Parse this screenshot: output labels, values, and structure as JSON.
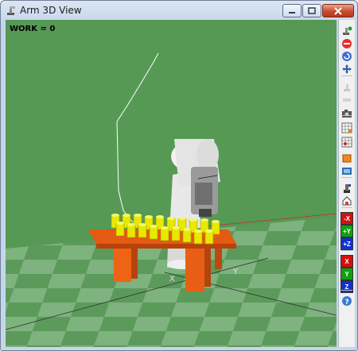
{
  "window": {
    "title": "Arm 3D View"
  },
  "viewport": {
    "work_label": "WORK = 0",
    "axis_x_label": "X",
    "axis_y_label": "Y",
    "background_color": "#559955",
    "floor_colors": [
      "#7eb27e",
      "#5c9a5c"
    ],
    "table_color": "#e2560f",
    "cylinder_color": "#e8e800",
    "robot_color": "#e6e6e6"
  },
  "toolbar": {
    "buttons": [
      {
        "icon": "robot-run-icon"
      },
      {
        "icon": "no-entry-icon"
      },
      {
        "icon": "refresh-icon"
      },
      {
        "icon": "move-arrows-icon"
      },
      {
        "icon": "robot-disabled-icon"
      },
      {
        "icon": "stripe-disabled-icon"
      },
      {
        "icon": "camera-icon"
      },
      {
        "icon": "grid-view-icon"
      },
      {
        "icon": "grid-point-icon"
      },
      {
        "icon": "orange-box-icon"
      },
      {
        "icon": "blue-panel-icon"
      },
      {
        "icon": "robot-small-icon"
      },
      {
        "icon": "home-robot-icon"
      },
      {
        "icon": "minus-x-icon",
        "label": "-X",
        "color": "#d01010"
      },
      {
        "icon": "plus-y-icon",
        "label": "+Y",
        "color": "#10a010"
      },
      {
        "icon": "plus-z-icon",
        "label": "+Z",
        "color": "#1030d0"
      },
      {
        "icon": "x-rotate-icon",
        "label": "X",
        "color": "#d01010"
      },
      {
        "icon": "y-rotate-icon",
        "label": "Y",
        "color": "#10a010"
      },
      {
        "icon": "z-rotate-icon",
        "label": "Z",
        "color": "#1030d0"
      },
      {
        "icon": "help-icon"
      }
    ]
  }
}
